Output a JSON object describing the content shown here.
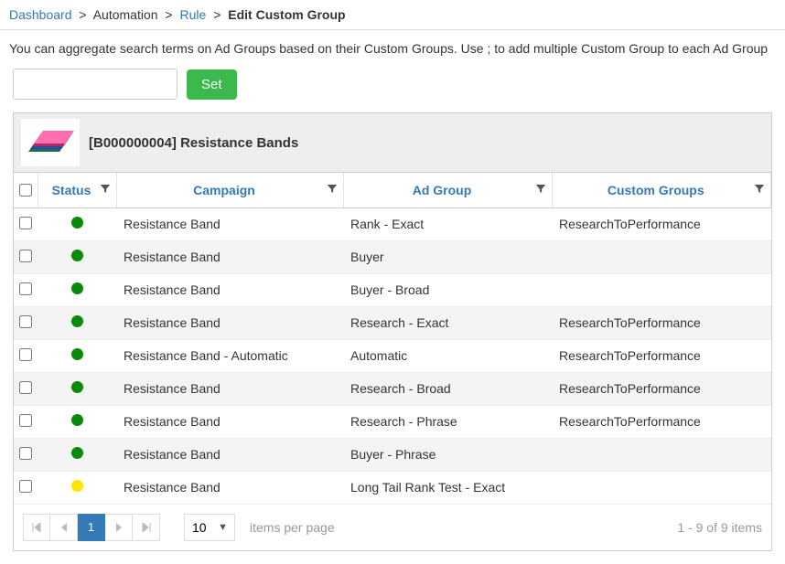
{
  "breadcrumb": {
    "items": [
      {
        "label": "Dashboard",
        "link": true
      },
      {
        "label": "Automation",
        "link": false
      },
      {
        "label": "Rule",
        "link": true
      },
      {
        "label": "Edit Custom Group",
        "link": false,
        "current": true
      }
    ]
  },
  "description": "You can aggregate search terms on Ad Groups based on their Custom Groups. Use ; to add multiple Custom Group to each Ad Group",
  "set": {
    "input_value": "",
    "placeholder": "",
    "button_label": "Set"
  },
  "product": {
    "title": "[B000000004] Resistance Bands"
  },
  "grid": {
    "columns": {
      "status": "Status",
      "campaign": "Campaign",
      "adgroup": "Ad Group",
      "customgroups": "Custom Groups"
    },
    "rows": [
      {
        "status": "green",
        "campaign": "Resistance Band",
        "adgroup": "Rank - Exact",
        "customgroups": "ResearchToPerformance"
      },
      {
        "status": "green",
        "campaign": "Resistance Band",
        "adgroup": "Buyer",
        "customgroups": ""
      },
      {
        "status": "green",
        "campaign": "Resistance Band",
        "adgroup": "Buyer - Broad",
        "customgroups": ""
      },
      {
        "status": "green",
        "campaign": "Resistance Band",
        "adgroup": "Research - Exact",
        "customgroups": "ResearchToPerformance"
      },
      {
        "status": "green",
        "campaign": "Resistance Band - Automatic",
        "adgroup": "Automatic",
        "customgroups": "ResearchToPerformance"
      },
      {
        "status": "green",
        "campaign": "Resistance Band",
        "adgroup": "Research - Broad",
        "customgroups": "ResearchToPerformance"
      },
      {
        "status": "green",
        "campaign": "Resistance Band",
        "adgroup": "Research - Phrase",
        "customgroups": "ResearchToPerformance"
      },
      {
        "status": "green",
        "campaign": "Resistance Band",
        "adgroup": "Buyer - Phrase",
        "customgroups": ""
      },
      {
        "status": "yellow",
        "campaign": "Resistance Band",
        "adgroup": "Long Tail Rank Test - Exact",
        "customgroups": ""
      }
    ]
  },
  "pager": {
    "page": "1",
    "page_size": "10",
    "items_per_page_label": "items per page",
    "info": "1 - 9 of 9 items"
  }
}
